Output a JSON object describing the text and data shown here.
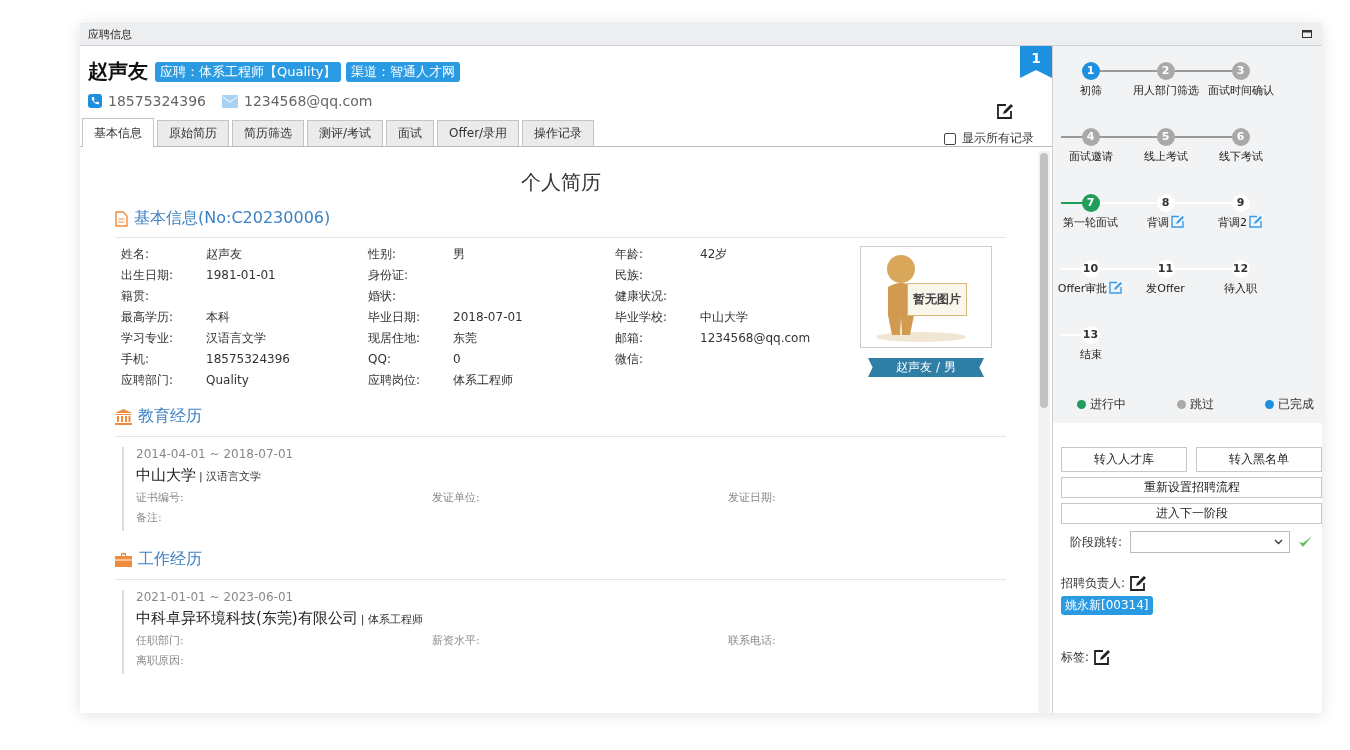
{
  "window": {
    "title": "应聘信息"
  },
  "candidate": {
    "name": "赵声友",
    "tags": [
      "应聘：体系工程师【Quality】",
      "渠道：智通人才网"
    ],
    "phone": "18575324396",
    "email": "1234568@qq.com"
  },
  "ribbon": "1",
  "tabs": [
    {
      "label": "基本信息",
      "selected": true
    },
    {
      "label": "原始简历",
      "selected": false
    },
    {
      "label": "简历筛选",
      "selected": false
    },
    {
      "label": "测评/考试",
      "selected": false
    },
    {
      "label": "面试",
      "selected": false
    },
    {
      "label": "Offer/录用",
      "selected": false
    },
    {
      "label": "操作记录",
      "selected": false
    }
  ],
  "show_all": {
    "label": "显示所有记录",
    "checked": false
  },
  "resume": {
    "title": "个人简历",
    "basic_title": "基本信息(No:C20230006)",
    "fields": [
      {
        "label": "姓名:",
        "value": "赵声友"
      },
      {
        "label": "性别:",
        "value": "男"
      },
      {
        "label": "年龄:",
        "value": "42岁"
      },
      {
        "label": "出生日期:",
        "value": "1981-01-01"
      },
      {
        "label": "身份证:"
      },
      {
        "label": "民族:"
      },
      {
        "label": "籍贯:"
      },
      {
        "label": "婚状:"
      },
      {
        "label": "健康状况:"
      },
      {
        "label": "最高学历:",
        "value": "本科"
      },
      {
        "label": "毕业日期:",
        "value": "2018-07-01"
      },
      {
        "label": "毕业学校:",
        "value": "中山大学"
      },
      {
        "label": "学习专业:",
        "value": "汉语言文学"
      },
      {
        "label": "现居住地:",
        "value": "东莞"
      },
      {
        "label": "邮箱:",
        "value": "1234568@qq.com"
      },
      {
        "label": "手机:",
        "value": "18575324396"
      },
      {
        "label": "QQ:",
        "value": "0"
      },
      {
        "label": "微信:"
      },
      {
        "label": "应聘部门:",
        "value": "Quality"
      },
      {
        "label": "应聘岗位:",
        "value": "体系工程师"
      }
    ],
    "photo_text": "暂无图片",
    "photo_caption": "赵声友 / 男",
    "sections": [
      {
        "kind": "education",
        "title": "教育经历",
        "entries": [
          {
            "period": "2014-04-01 ~ 2018-07-01",
            "org": "中山大学",
            "role": "| 汉语言文学",
            "labels": [
              "证书编号:",
              "发证单位:",
              "发证日期:",
              "备注:"
            ]
          }
        ]
      },
      {
        "kind": "work",
        "title": "工作经历",
        "entries": [
          {
            "period": "2021-01-01 ~ 2023-06-01",
            "org": "中科卓异环境科技(东莞)有限公司",
            "role": "| 体系工程师",
            "labels": [
              "任职部门:",
              "薪资水平:",
              "联系电话:",
              "离职原因:"
            ]
          }
        ]
      }
    ]
  },
  "steps": [
    {
      "num": "1",
      "label": "初筛",
      "kind": "done",
      "editable": false
    },
    {
      "num": "2",
      "label": "用人部门筛选",
      "kind": "skipped",
      "editable": false
    },
    {
      "num": "3",
      "label": "面试时间确认",
      "kind": "skipped",
      "editable": false
    },
    {
      "num": "4",
      "label": "面试邀请",
      "kind": "skipped",
      "editable": false
    },
    {
      "num": "5",
      "label": "线上考试",
      "kind": "skipped",
      "editable": false
    },
    {
      "num": "6",
      "label": "线下考试",
      "kind": "skipped",
      "editable": false
    },
    {
      "num": "7",
      "label": "第一轮面试",
      "kind": "current",
      "editable": false
    },
    {
      "num": "8",
      "label": "背调",
      "kind": "pending",
      "editable": true
    },
    {
      "num": "9",
      "label": "背调2",
      "kind": "pending",
      "editable": true
    },
    {
      "num": "10",
      "label": "Offer审批",
      "kind": "pending",
      "editable": true
    },
    {
      "num": "11",
      "label": "发Offer",
      "kind": "pending",
      "editable": false
    },
    {
      "num": "12",
      "label": "待入职",
      "kind": "pending",
      "editable": false
    },
    {
      "num": "13",
      "label": "结束",
      "kind": "pending",
      "editable": false
    }
  ],
  "legend": [
    {
      "label": "进行中",
      "color": "#1e9e5a"
    },
    {
      "label": "跳过",
      "color": "#a9a9a9"
    },
    {
      "label": "已完成",
      "color": "#1e90e0"
    }
  ],
  "actions": {
    "buttons_row": [
      "转入人才库",
      "转入黑名单"
    ],
    "buttons": [
      "重新设置招聘流程",
      "进入下一阶段"
    ],
    "jump_label": "阶段跳转:"
  },
  "owner": {
    "label": "招聘负责人:",
    "tag": "姚永新[00314]"
  },
  "tags_label": "标签:"
}
